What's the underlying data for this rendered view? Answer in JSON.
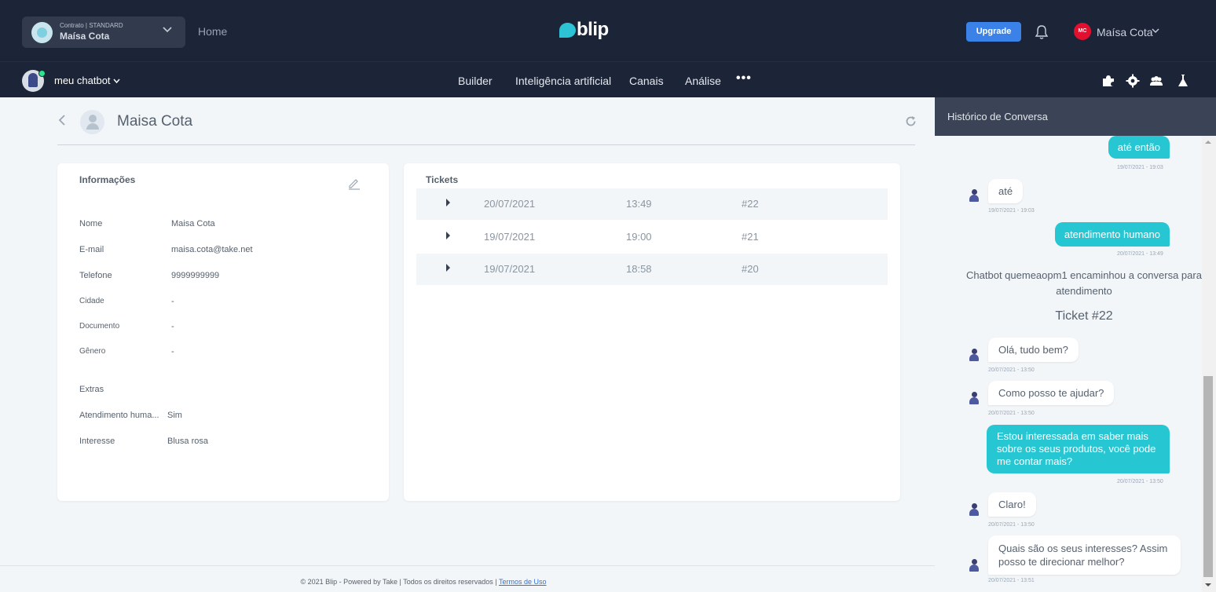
{
  "topbar": {
    "contract_label": "Contrato | STANDARD",
    "contract_name": "Maísa Cota",
    "home": "Home",
    "logo_text": "blip",
    "upgrade": "Upgrade",
    "user_initials": "MC",
    "user_name": "Maísa Cota"
  },
  "subnav": {
    "bot_name": "meu chatbot",
    "items": [
      "Builder",
      "Inteligência artificial",
      "Canais",
      "Análise"
    ],
    "more": "•••"
  },
  "contact": {
    "name": "Maisa Cota"
  },
  "info": {
    "title": "Informações",
    "fields": [
      {
        "label": "Nome",
        "value": "Maisa Cota"
      },
      {
        "label": "E-mail",
        "value": "maisa.cota@take.net"
      },
      {
        "label": "Telefone",
        "value": "9999999999"
      },
      {
        "label": "Cidade",
        "value": "-"
      },
      {
        "label": "Documento",
        "value": "-"
      },
      {
        "label": "Gênero",
        "value": "-"
      }
    ],
    "extras_title": "Extras",
    "extras": [
      {
        "label": "Atendimento huma...",
        "value": "Sim"
      },
      {
        "label": "Interesse",
        "value": "Blusa rosa"
      }
    ]
  },
  "tickets": {
    "title": "Tickets",
    "rows": [
      {
        "date": "20/07/2021",
        "time": "13:49",
        "id": "#22"
      },
      {
        "date": "19/07/2021",
        "time": "19:00",
        "id": "#21"
      },
      {
        "date": "19/07/2021",
        "time": "18:58",
        "id": "#20"
      }
    ]
  },
  "footer": {
    "text": "© 2021 Blip - Powered by Take | Todos os direitos reservados |",
    "link": "Termos de Uso"
  },
  "history": {
    "title": "Histórico de Conversa",
    "msg1": {
      "text": "até então",
      "ts": "19/07/2021 - 19:03"
    },
    "msg2": {
      "text": "até",
      "ts": "19/07/2021 - 19:03"
    },
    "msg3": {
      "text": "atendimento humano",
      "ts": "20/07/2021 - 13:49"
    },
    "system": "Chatbot quemeaopm1 encaminhou a conversa para atendimento",
    "ticket": "Ticket #22",
    "msg4": {
      "text": "Olá, tudo bem?",
      "ts": "20/07/2021 - 13:50"
    },
    "msg5": {
      "text": "Como posso te ajudar?",
      "ts": "20/07/2021 - 13:50"
    },
    "msg6": {
      "text": "Estou interessada em saber mais sobre os seus produtos, você pode me contar mais?",
      "ts": "20/07/2021 - 13:50"
    },
    "msg7": {
      "text": "Claro!",
      "ts": "20/07/2021 - 13:50"
    },
    "msg8": {
      "text": "Quais são os seus interesses? Assim posso te direcionar melhor?",
      "ts": "20/07/2021 - 13:51"
    }
  },
  "colors": {
    "topbar": "#1c2538",
    "accent": "#27c6d3",
    "upgrade": "#3b82e8",
    "avatar_badge": "#e30f2f"
  }
}
